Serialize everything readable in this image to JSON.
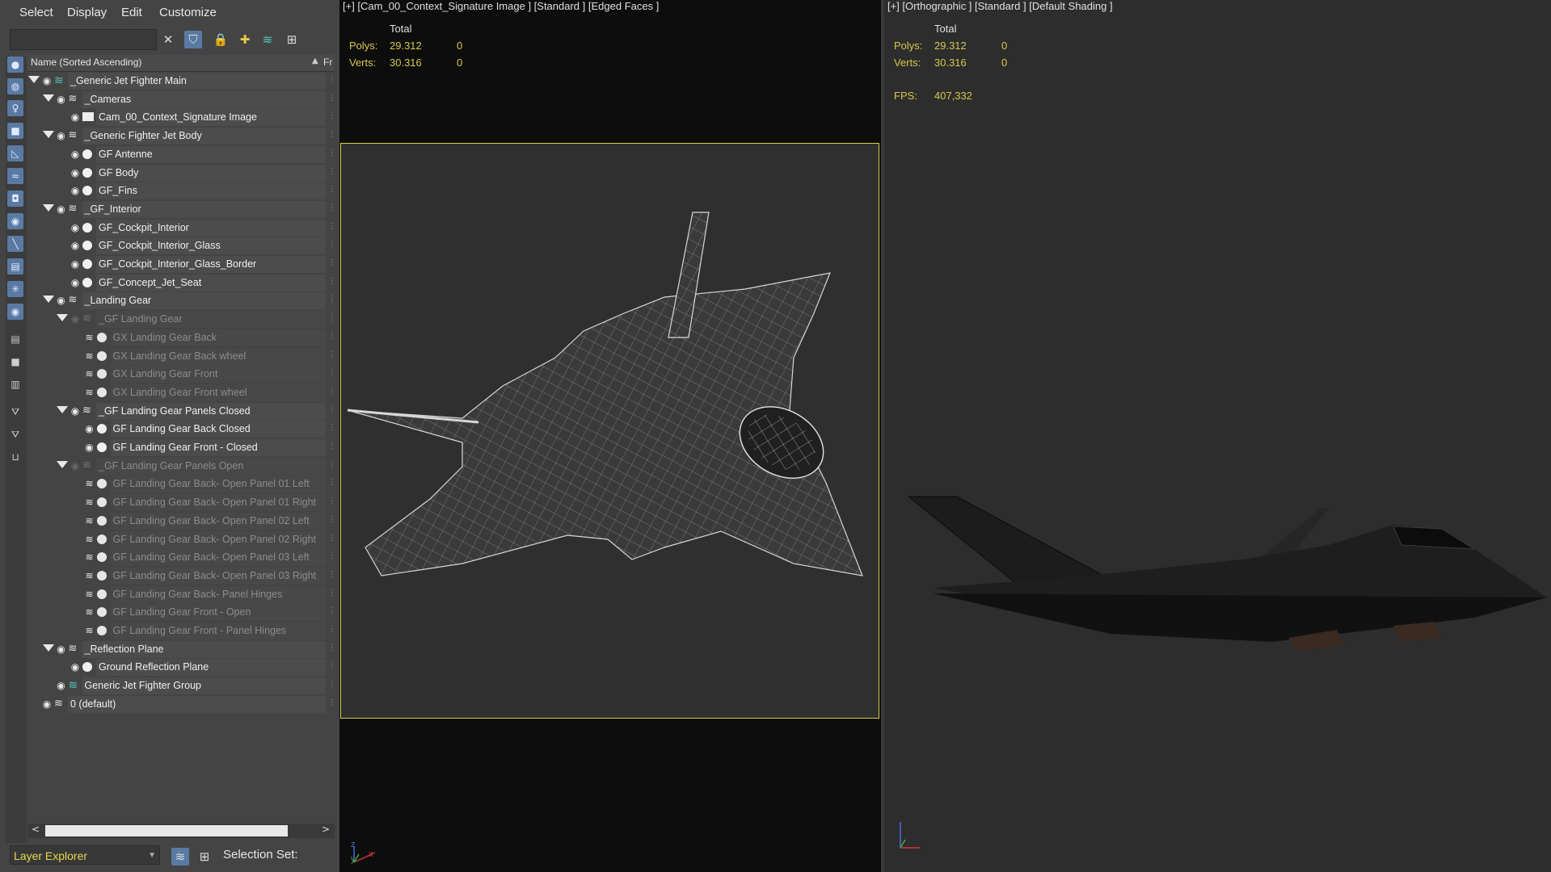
{
  "menu": [
    "Select",
    "Display",
    "Edit",
    "Customize"
  ],
  "explorer": {
    "column_name": "Name (Sorted Ascending)",
    "column_fr": "Fr",
    "layer_explorer": "Layer Explorer",
    "selection_set": "Selection Set:"
  },
  "tree": [
    {
      "label": "_Generic Jet Fighter Main",
      "dim": false
    },
    {
      "label": "_Cameras",
      "dim": false
    },
    {
      "label": "Cam_00_Context_Signature Image",
      "dim": false
    },
    {
      "label": "_Generic Fighter Jet Body",
      "dim": false
    },
    {
      "label": "GF Antenne",
      "dim": false
    },
    {
      "label": "GF Body",
      "dim": false
    },
    {
      "label": "GF_Fins",
      "dim": false
    },
    {
      "label": "_GF_Interior",
      "dim": false
    },
    {
      "label": "GF_Cockpit_Interior",
      "dim": false
    },
    {
      "label": "GF_Cockpit_Interior_Glass",
      "dim": false
    },
    {
      "label": "GF_Cockpit_Interior_Glass_Border",
      "dim": false
    },
    {
      "label": "GF_Concept_Jet_Seat",
      "dim": false
    },
    {
      "label": "_Landing Gear",
      "dim": false
    },
    {
      "label": "_GF Landing Gear",
      "dim": true
    },
    {
      "label": "GX Landing Gear Back",
      "dim": true
    },
    {
      "label": "GX Landing Gear Back wheel",
      "dim": true
    },
    {
      "label": "GX Landing Gear Front",
      "dim": true
    },
    {
      "label": "GX Landing Gear Front wheel",
      "dim": true
    },
    {
      "label": "_GF Landing Gear Panels Closed",
      "dim": false
    },
    {
      "label": "GF Landing Gear Back Closed",
      "dim": false
    },
    {
      "label": "GF Landing Gear Front - Closed",
      "dim": false
    },
    {
      "label": "_GF Landing Gear Panels Open",
      "dim": true
    },
    {
      "label": "GF Landing Gear Back- Open Panel 01 Left",
      "dim": true
    },
    {
      "label": "GF Landing Gear Back- Open Panel 01 Right",
      "dim": true
    },
    {
      "label": "GF Landing Gear Back- Open Panel 02 Left",
      "dim": true
    },
    {
      "label": "GF Landing Gear Back- Open Panel 02 Right",
      "dim": true
    },
    {
      "label": "GF Landing Gear Back- Open Panel 03 Left",
      "dim": true
    },
    {
      "label": "GF Landing Gear Back- Open Panel 03 Right",
      "dim": true
    },
    {
      "label": "GF Landing Gear Back- Panel Hinges",
      "dim": true
    },
    {
      "label": "GF Landing Gear Front - Open",
      "dim": true
    },
    {
      "label": "GF Landing Gear Front - Panel Hinges",
      "dim": true
    },
    {
      "label": "_Reflection Plane",
      "dim": false
    },
    {
      "label": "Ground Reflection Plane",
      "dim": false
    },
    {
      "label": "Generic Jet Fighter Group",
      "dim": false
    },
    {
      "label": "0 (default)",
      "dim": false
    }
  ],
  "viewport1": {
    "title": "[+] [Cam_00_Context_Signature Image ] [Standard ] [Edged Faces ]",
    "total": "Total",
    "polys_label": "Polys:",
    "polys_value": "29.312",
    "polys_sel": "0",
    "verts_label": "Verts:",
    "verts_value": "30.316",
    "verts_sel": "0"
  },
  "viewport2": {
    "title": "[+] [Orthographic ] [Standard ] [Default Shading ]",
    "total": "Total",
    "polys_label": "Polys:",
    "polys_value": "29.312",
    "polys_sel": "0",
    "verts_label": "Verts:",
    "verts_value": "30.316",
    "verts_sel": "0",
    "fps_label": "FPS:",
    "fps_value": "407,332"
  },
  "axis": {
    "x": "x",
    "y": "y",
    "z": "z"
  },
  "colors": {
    "accent_yellow": "#d8c84a",
    "viewport_border": "#d8cf4a",
    "layer_icon": "#52c7c0",
    "tool_blue": "#5a7aa3"
  }
}
